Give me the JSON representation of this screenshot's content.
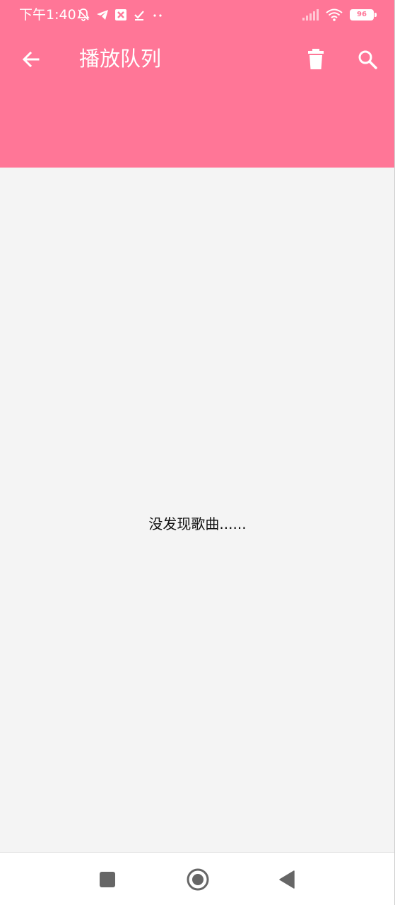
{
  "status_bar": {
    "time": "下午1:40",
    "battery_level": "96",
    "left_icons": [
      "notifications-off-icon",
      "telegram-icon",
      "app-x-icon",
      "check-download-icon",
      "more-dots-icon"
    ],
    "right_icons": [
      "signal-icon",
      "wifi-icon",
      "battery-icon"
    ]
  },
  "header": {
    "title": "播放队列",
    "back_icon": "arrow-back-icon",
    "clear_icon": "trash-icon",
    "search_icon": "search-icon"
  },
  "content": {
    "empty_message": "没发现歌曲......"
  },
  "nav_bar": {
    "buttons": [
      "recents-square-icon",
      "home-circle-icon",
      "back-triangle-icon"
    ]
  },
  "colors": {
    "accent": "#ff7697",
    "background": "#f4f4f4",
    "nav_icon": "#666666"
  }
}
